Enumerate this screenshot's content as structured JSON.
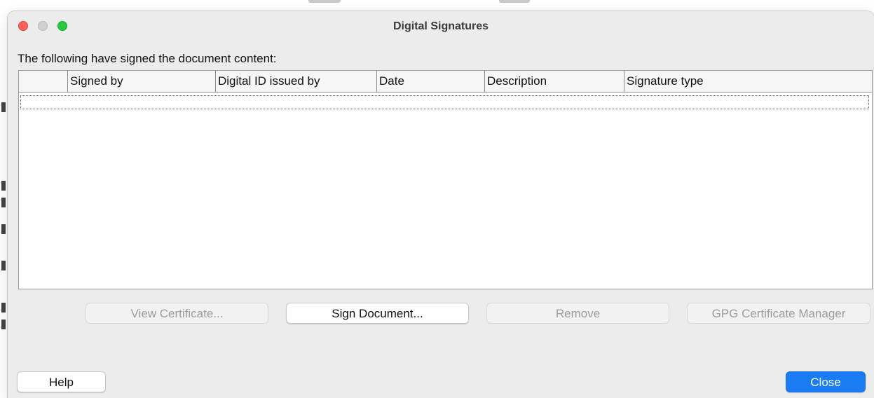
{
  "window": {
    "title": "Digital Signatures"
  },
  "intro_text": "The following have signed the document content:",
  "table": {
    "columns": [
      "",
      "Signed by",
      "Digital ID issued by",
      "Date",
      "Description",
      "Signature type"
    ],
    "rows": []
  },
  "buttons": {
    "view_certificate": "View Certificate...",
    "sign_document": "Sign Document...",
    "remove": "Remove",
    "gpg_manager": "GPG Certificate Manager",
    "help": "Help",
    "close": "Close"
  },
  "colors": {
    "accent": "#1a7cf5",
    "traffic_close": "#ff5f57",
    "traffic_minimize_inactive": "#d0d0d0",
    "traffic_maximize": "#28c840",
    "window_background": "#ececec"
  }
}
